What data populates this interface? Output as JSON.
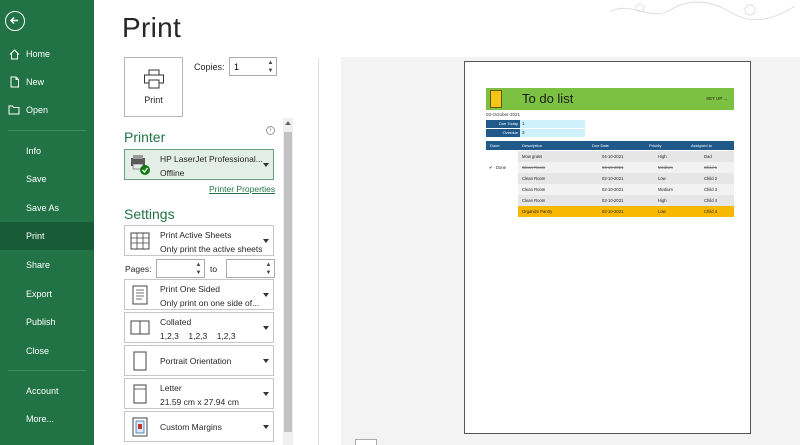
{
  "nav": {
    "items": [
      {
        "key": "home",
        "label": "Home",
        "icon": "home-icon"
      },
      {
        "key": "new",
        "label": "New",
        "icon": "new-document-icon"
      },
      {
        "key": "open",
        "label": "Open",
        "icon": "folder-icon"
      },
      {
        "key": "info",
        "label": "Info"
      },
      {
        "key": "save",
        "label": "Save"
      },
      {
        "key": "save-as",
        "label": "Save As"
      },
      {
        "key": "print",
        "label": "Print",
        "active": true
      },
      {
        "key": "share",
        "label": "Share"
      },
      {
        "key": "export",
        "label": "Export"
      },
      {
        "key": "publish",
        "label": "Publish"
      },
      {
        "key": "close",
        "label": "Close"
      },
      {
        "key": "account",
        "label": "Account"
      },
      {
        "key": "more",
        "label": "More..."
      }
    ]
  },
  "panel": {
    "title": "Print",
    "print_button": "Print",
    "copies_label": "Copies:",
    "copies_value": "1",
    "printer_heading": "Printer",
    "printer_name": "HP LaserJet Professional...",
    "printer_status": "Offline",
    "printer_properties": "Printer Properties",
    "settings_heading": "Settings",
    "pages_label": "Pages:",
    "pages_to": "to",
    "settings": [
      {
        "key": "sheets",
        "line1": "Print Active Sheets",
        "line2": "Only print the active sheets",
        "icon": "sheet-grid-icon"
      },
      {
        "key": "sided",
        "line1": "Print One Sided",
        "line2": "Only print on one side of...",
        "icon": "one-sided-icon"
      },
      {
        "key": "collated",
        "line1": "Collated",
        "line2": "1,2,3    1,2,3    1,2,3",
        "icon": "collated-icon"
      },
      {
        "key": "orientation",
        "line1": "Portrait Orientation",
        "line2": "",
        "icon": "portrait-icon"
      },
      {
        "key": "paper",
        "line1": "Letter",
        "line2": "21.59 cm x 27.94 cm",
        "icon": "paper-size-icon"
      },
      {
        "key": "margins",
        "line1": "Custom Margins",
        "line2": "",
        "icon": "margins-icon"
      }
    ]
  },
  "sheet": {
    "title": "To do list",
    "setup": "SET UP →",
    "date": "03-October-2021",
    "due_today_label": "Due Today",
    "due_today_value": "1",
    "overdue_label": "Overdue",
    "overdue_value": "3",
    "headers": [
      "Done",
      "Description",
      "Due Date",
      "Priority",
      "Assigned to"
    ],
    "rows": [
      {
        "done": "",
        "desc": "Mow grass",
        "due": "04-10-2021",
        "priority": "High",
        "assigned": "Dad",
        "struck": false,
        "bg": "#e6e6e6"
      },
      {
        "done": "Done",
        "desc": "Clean Room",
        "due": "03-10-2021",
        "priority": "Medium",
        "assigned": "Child 1",
        "struck": true,
        "bg": "#f2f2f2"
      },
      {
        "done": "",
        "desc": "Clean Room",
        "due": "02-10-2021",
        "priority": "Low",
        "assigned": "Child 2",
        "struck": false,
        "bg": "#e6e6e6"
      },
      {
        "done": "",
        "desc": "Clean Room",
        "due": "02-10-2021",
        "priority": "Medium",
        "assigned": "Child 3",
        "struck": false,
        "bg": "#f2f2f2"
      },
      {
        "done": "",
        "desc": "Clean Room",
        "due": "02-10-2021",
        "priority": "High",
        "assigned": "Child 4",
        "struck": false,
        "bg": "#e6e6e6"
      },
      {
        "done": "",
        "desc": "Organize Pantry",
        "due": "02-10-2021",
        "priority": "Low",
        "assigned": "Child 4",
        "struck": false,
        "bg": "#f9b800"
      }
    ]
  },
  "colors": {
    "nav_bg": "#217346",
    "nav_active": "#185c37",
    "accent": "#217346",
    "banner": "#7cc142",
    "table_header": "#1f5a8a"
  }
}
